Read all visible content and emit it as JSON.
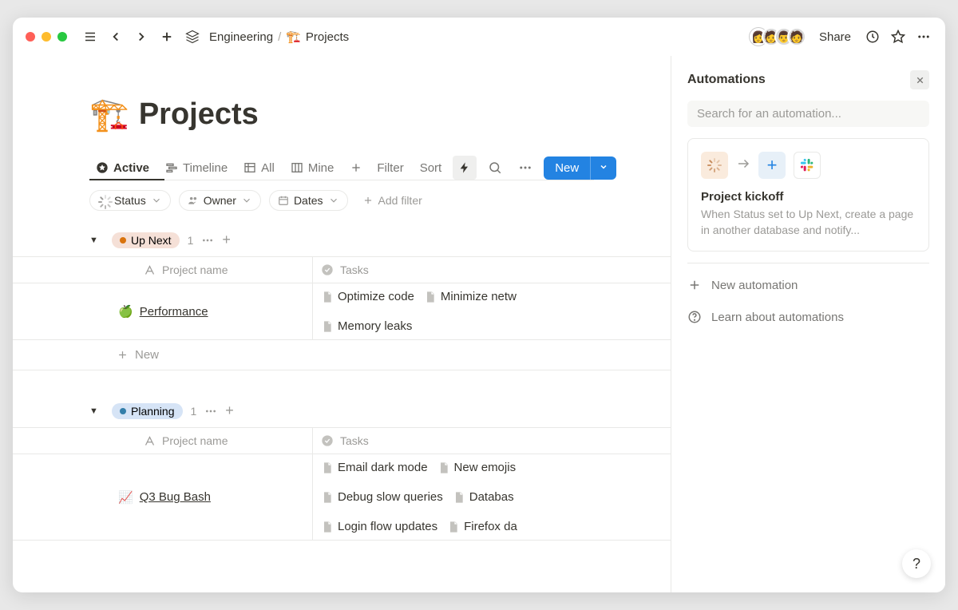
{
  "topbar": {
    "breadcrumb_parent": "Engineering",
    "breadcrumb_sep": "/",
    "breadcrumb_emoji": "🏗️",
    "breadcrumb_current": "Projects",
    "share_label": "Share"
  },
  "page": {
    "emoji": "🏗️",
    "title": "Projects"
  },
  "views": {
    "tabs": [
      {
        "label": "Active"
      },
      {
        "label": "Timeline"
      },
      {
        "label": "All"
      },
      {
        "label": "Mine"
      }
    ],
    "filter_label": "Filter",
    "sort_label": "Sort",
    "new_label": "New"
  },
  "filters": {
    "chips": [
      {
        "label": "Status"
      },
      {
        "label": "Owner"
      },
      {
        "label": "Dates"
      }
    ],
    "add_label": "Add filter"
  },
  "groups": [
    {
      "pill_label": "Up Next",
      "pill_bg": "#f5e0d7",
      "pill_dot": "#d9730d",
      "count": "1",
      "columns": {
        "name": "Project name",
        "tasks": "Tasks"
      },
      "rows": [
        {
          "emoji": "🍏",
          "name": "Performance",
          "tasks": [
            "Optimize code",
            "Minimize netw",
            "Memory leaks"
          ]
        }
      ],
      "new_label": "New"
    },
    {
      "pill_label": "Planning",
      "pill_bg": "#d6e4f6",
      "pill_dot": "#337ea9",
      "count": "1",
      "columns": {
        "name": "Project name",
        "tasks": "Tasks"
      },
      "rows": [
        {
          "emoji": "📈",
          "name": "Q3 Bug Bash",
          "tasks": [
            "Email dark mode",
            "New emojis",
            "Debug slow queries",
            "Databas",
            "Login flow updates",
            "Firefox da"
          ]
        }
      ]
    }
  ],
  "automations": {
    "title": "Automations",
    "search_placeholder": "Search for an automation...",
    "card": {
      "title": "Project kickoff",
      "desc": "When Status set to Up Next, create a page in another database and notify..."
    },
    "new_label": "New automation",
    "learn_label": "Learn about automations"
  },
  "help_label": "?"
}
